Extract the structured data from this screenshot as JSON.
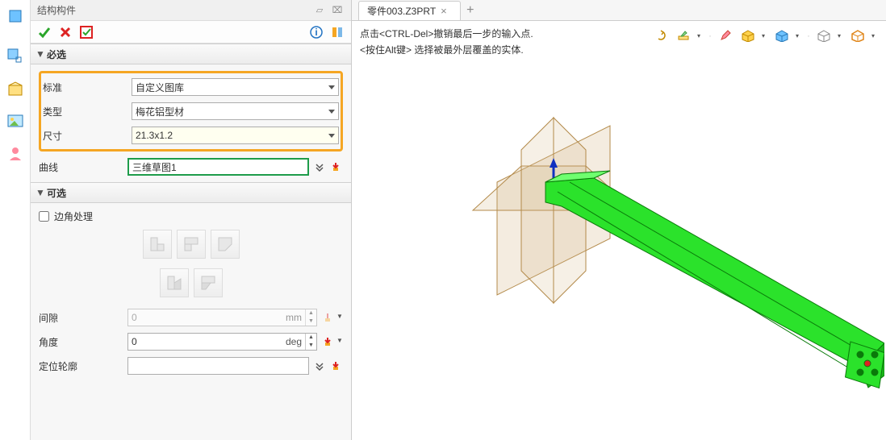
{
  "panel": {
    "title": "结构构件",
    "sections": {
      "required": {
        "label": "必选"
      },
      "optional": {
        "label": "可选"
      }
    },
    "labels": {
      "standard": "标准",
      "type": "类型",
      "size": "尺寸",
      "curve": "曲线",
      "corner": "边角处理",
      "gap": "间隙",
      "angle": "角度",
      "profile": "定位轮廓"
    },
    "values": {
      "standard": "自定义图库",
      "type": "梅花铝型材",
      "size": "21.3x1.2",
      "curve": "三维草图1",
      "gap": "0",
      "gap_unit": "mm",
      "angle": "0",
      "angle_unit": "deg",
      "profile": ""
    }
  },
  "tab": {
    "label": "零件003.Z3PRT"
  },
  "hints": {
    "line1": "点击<CTRL-Del>撤销最后一步的输入点.",
    "line2": "<按住Alt键> 选择被最外层覆盖的实体."
  },
  "icons": {
    "check": "check-icon",
    "cross": "cross-icon",
    "apply": "apply-check-icon",
    "info": "info-icon",
    "side": "sidepanel-icon"
  }
}
